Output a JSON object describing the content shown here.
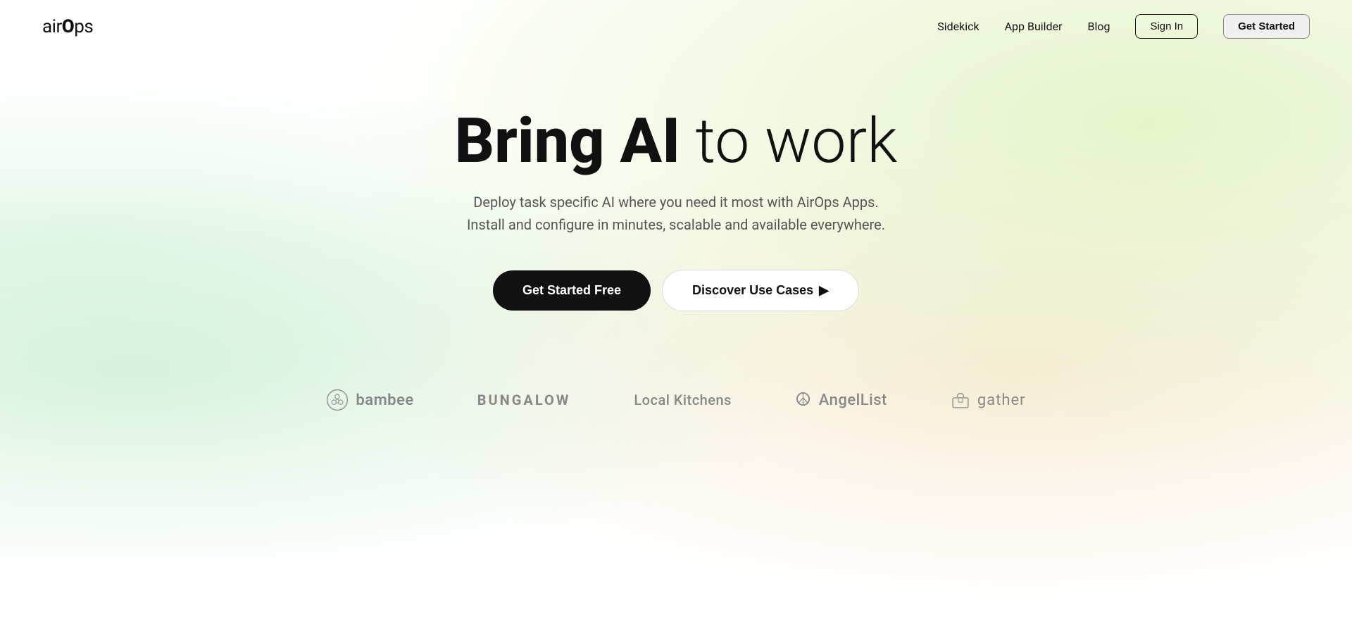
{
  "nav": {
    "logo": "airOps",
    "links": [
      {
        "label": "Sidekick",
        "id": "sidekick"
      },
      {
        "label": "App Builder",
        "id": "app-builder"
      },
      {
        "label": "Blog",
        "id": "blog"
      }
    ],
    "signin_label": "Sign In",
    "getstarted_label": "Get Started"
  },
  "hero": {
    "title_bold": "Bring AI",
    "title_light": " to work",
    "subtitle_line1": "Deploy task specific AI where you need it most with AirOps Apps.",
    "subtitle_line2": "Install and configure in minutes, scalable and available everywhere.",
    "btn_primary": "Get Started Free",
    "btn_secondary": "Discover Use Cases",
    "btn_secondary_icon": "▶"
  },
  "logos": [
    {
      "id": "bambee",
      "label": "bambee",
      "has_icon": true
    },
    {
      "id": "bungalow",
      "label": "BUNGALOW",
      "has_icon": false
    },
    {
      "id": "local-kitchens",
      "label": "Local Kitchens",
      "has_icon": false
    },
    {
      "id": "angellist",
      "label": "AngelList",
      "has_icon": true
    },
    {
      "id": "gather",
      "label": "gather",
      "has_icon": true
    }
  ]
}
